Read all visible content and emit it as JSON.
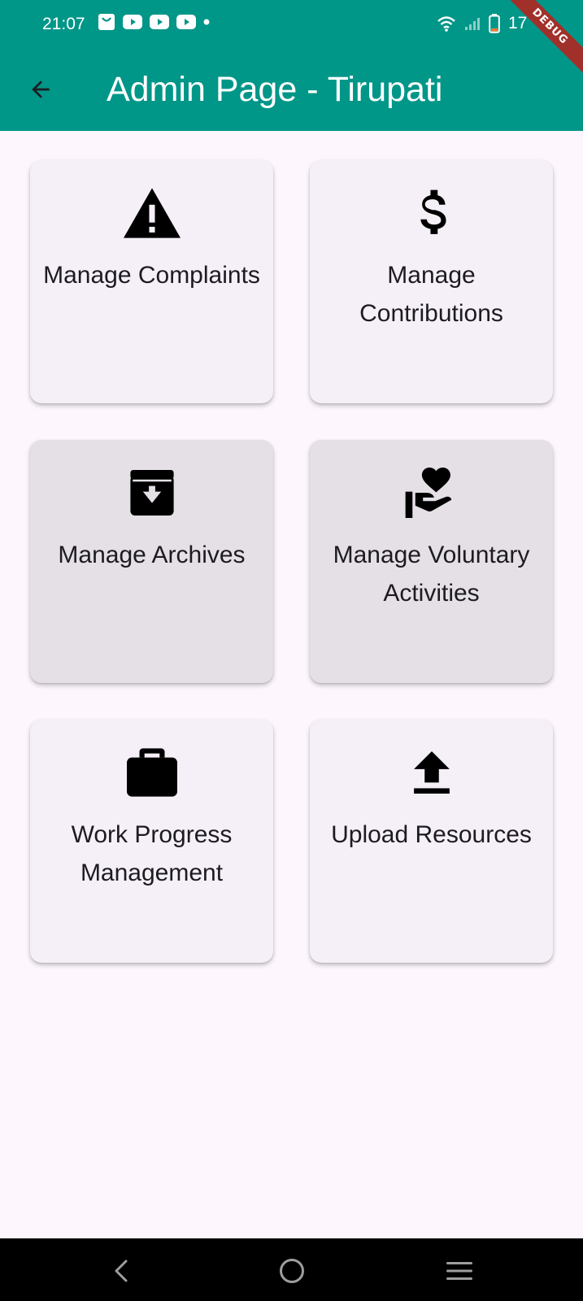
{
  "status_bar": {
    "time": "21:07",
    "battery_text": "17",
    "notification_icons": [
      "shopping-bag-icon",
      "youtube-icon",
      "youtube-icon",
      "youtube-icon",
      "dot-icon"
    ],
    "system_icons": [
      "wifi-icon",
      "signal-icon",
      "battery-icon"
    ]
  },
  "debug_banner": "DEBUG",
  "app_bar": {
    "title": "Admin Page - Tirupati",
    "back_icon": "arrow-back-icon",
    "background_color": "#009688"
  },
  "cards": [
    {
      "label": "Manage Complaints",
      "icon": "warning-icon"
    },
    {
      "label": "Manage Contributions",
      "icon": "dollar-icon"
    },
    {
      "label": "Manage Archives",
      "icon": "archive-icon"
    },
    {
      "label": "Manage Voluntary Activities",
      "icon": "volunteer-icon"
    },
    {
      "label": "Work Progress Management",
      "icon": "briefcase-icon"
    },
    {
      "label": "Upload Resources",
      "icon": "upload-icon"
    }
  ],
  "nav_bar": {
    "buttons": [
      "back-nav-icon",
      "home-nav-icon",
      "menu-nav-icon"
    ]
  },
  "colors": {
    "primary": "#009688",
    "card": "#f5f0f8",
    "card_pressed": "#e4e0e6",
    "background": "#fdf7fd"
  }
}
